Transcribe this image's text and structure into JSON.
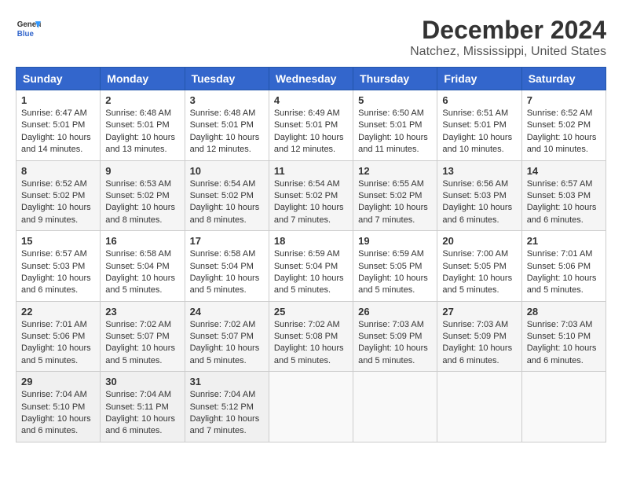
{
  "header": {
    "logo_line1": "General",
    "logo_line2": "Blue",
    "title": "December 2024",
    "subtitle": "Natchez, Mississippi, United States"
  },
  "columns": [
    "Sunday",
    "Monday",
    "Tuesday",
    "Wednesday",
    "Thursday",
    "Friday",
    "Saturday"
  ],
  "weeks": [
    [
      {
        "day": 1,
        "rise": "6:47 AM",
        "set": "5:01 PM",
        "daylight": "10 hours and 14 minutes."
      },
      {
        "day": 2,
        "rise": "6:48 AM",
        "set": "5:01 PM",
        "daylight": "10 hours and 13 minutes."
      },
      {
        "day": 3,
        "rise": "6:48 AM",
        "set": "5:01 PM",
        "daylight": "10 hours and 12 minutes."
      },
      {
        "day": 4,
        "rise": "6:49 AM",
        "set": "5:01 PM",
        "daylight": "10 hours and 12 minutes."
      },
      {
        "day": 5,
        "rise": "6:50 AM",
        "set": "5:01 PM",
        "daylight": "10 hours and 11 minutes."
      },
      {
        "day": 6,
        "rise": "6:51 AM",
        "set": "5:01 PM",
        "daylight": "10 hours and 10 minutes."
      },
      {
        "day": 7,
        "rise": "6:52 AM",
        "set": "5:02 PM",
        "daylight": "10 hours and 10 minutes."
      }
    ],
    [
      {
        "day": 8,
        "rise": "6:52 AM",
        "set": "5:02 PM",
        "daylight": "10 hours and 9 minutes."
      },
      {
        "day": 9,
        "rise": "6:53 AM",
        "set": "5:02 PM",
        "daylight": "10 hours and 8 minutes."
      },
      {
        "day": 10,
        "rise": "6:54 AM",
        "set": "5:02 PM",
        "daylight": "10 hours and 8 minutes."
      },
      {
        "day": 11,
        "rise": "6:54 AM",
        "set": "5:02 PM",
        "daylight": "10 hours and 7 minutes."
      },
      {
        "day": 12,
        "rise": "6:55 AM",
        "set": "5:02 PM",
        "daylight": "10 hours and 7 minutes."
      },
      {
        "day": 13,
        "rise": "6:56 AM",
        "set": "5:03 PM",
        "daylight": "10 hours and 6 minutes."
      },
      {
        "day": 14,
        "rise": "6:57 AM",
        "set": "5:03 PM",
        "daylight": "10 hours and 6 minutes."
      }
    ],
    [
      {
        "day": 15,
        "rise": "6:57 AM",
        "set": "5:03 PM",
        "daylight": "10 hours and 6 minutes."
      },
      {
        "day": 16,
        "rise": "6:58 AM",
        "set": "5:04 PM",
        "daylight": "10 hours and 5 minutes."
      },
      {
        "day": 17,
        "rise": "6:58 AM",
        "set": "5:04 PM",
        "daylight": "10 hours and 5 minutes."
      },
      {
        "day": 18,
        "rise": "6:59 AM",
        "set": "5:04 PM",
        "daylight": "10 hours and 5 minutes."
      },
      {
        "day": 19,
        "rise": "6:59 AM",
        "set": "5:05 PM",
        "daylight": "10 hours and 5 minutes."
      },
      {
        "day": 20,
        "rise": "7:00 AM",
        "set": "5:05 PM",
        "daylight": "10 hours and 5 minutes."
      },
      {
        "day": 21,
        "rise": "7:01 AM",
        "set": "5:06 PM",
        "daylight": "10 hours and 5 minutes."
      }
    ],
    [
      {
        "day": 22,
        "rise": "7:01 AM",
        "set": "5:06 PM",
        "daylight": "10 hours and 5 minutes."
      },
      {
        "day": 23,
        "rise": "7:02 AM",
        "set": "5:07 PM",
        "daylight": "10 hours and 5 minutes."
      },
      {
        "day": 24,
        "rise": "7:02 AM",
        "set": "5:07 PM",
        "daylight": "10 hours and 5 minutes."
      },
      {
        "day": 25,
        "rise": "7:02 AM",
        "set": "5:08 PM",
        "daylight": "10 hours and 5 minutes."
      },
      {
        "day": 26,
        "rise": "7:03 AM",
        "set": "5:09 PM",
        "daylight": "10 hours and 5 minutes."
      },
      {
        "day": 27,
        "rise": "7:03 AM",
        "set": "5:09 PM",
        "daylight": "10 hours and 6 minutes."
      },
      {
        "day": 28,
        "rise": "7:03 AM",
        "set": "5:10 PM",
        "daylight": "10 hours and 6 minutes."
      }
    ],
    [
      {
        "day": 29,
        "rise": "7:04 AM",
        "set": "5:10 PM",
        "daylight": "10 hours and 6 minutes."
      },
      {
        "day": 30,
        "rise": "7:04 AM",
        "set": "5:11 PM",
        "daylight": "10 hours and 6 minutes."
      },
      {
        "day": 31,
        "rise": "7:04 AM",
        "set": "5:12 PM",
        "daylight": "10 hours and 7 minutes."
      },
      null,
      null,
      null,
      null
    ]
  ]
}
